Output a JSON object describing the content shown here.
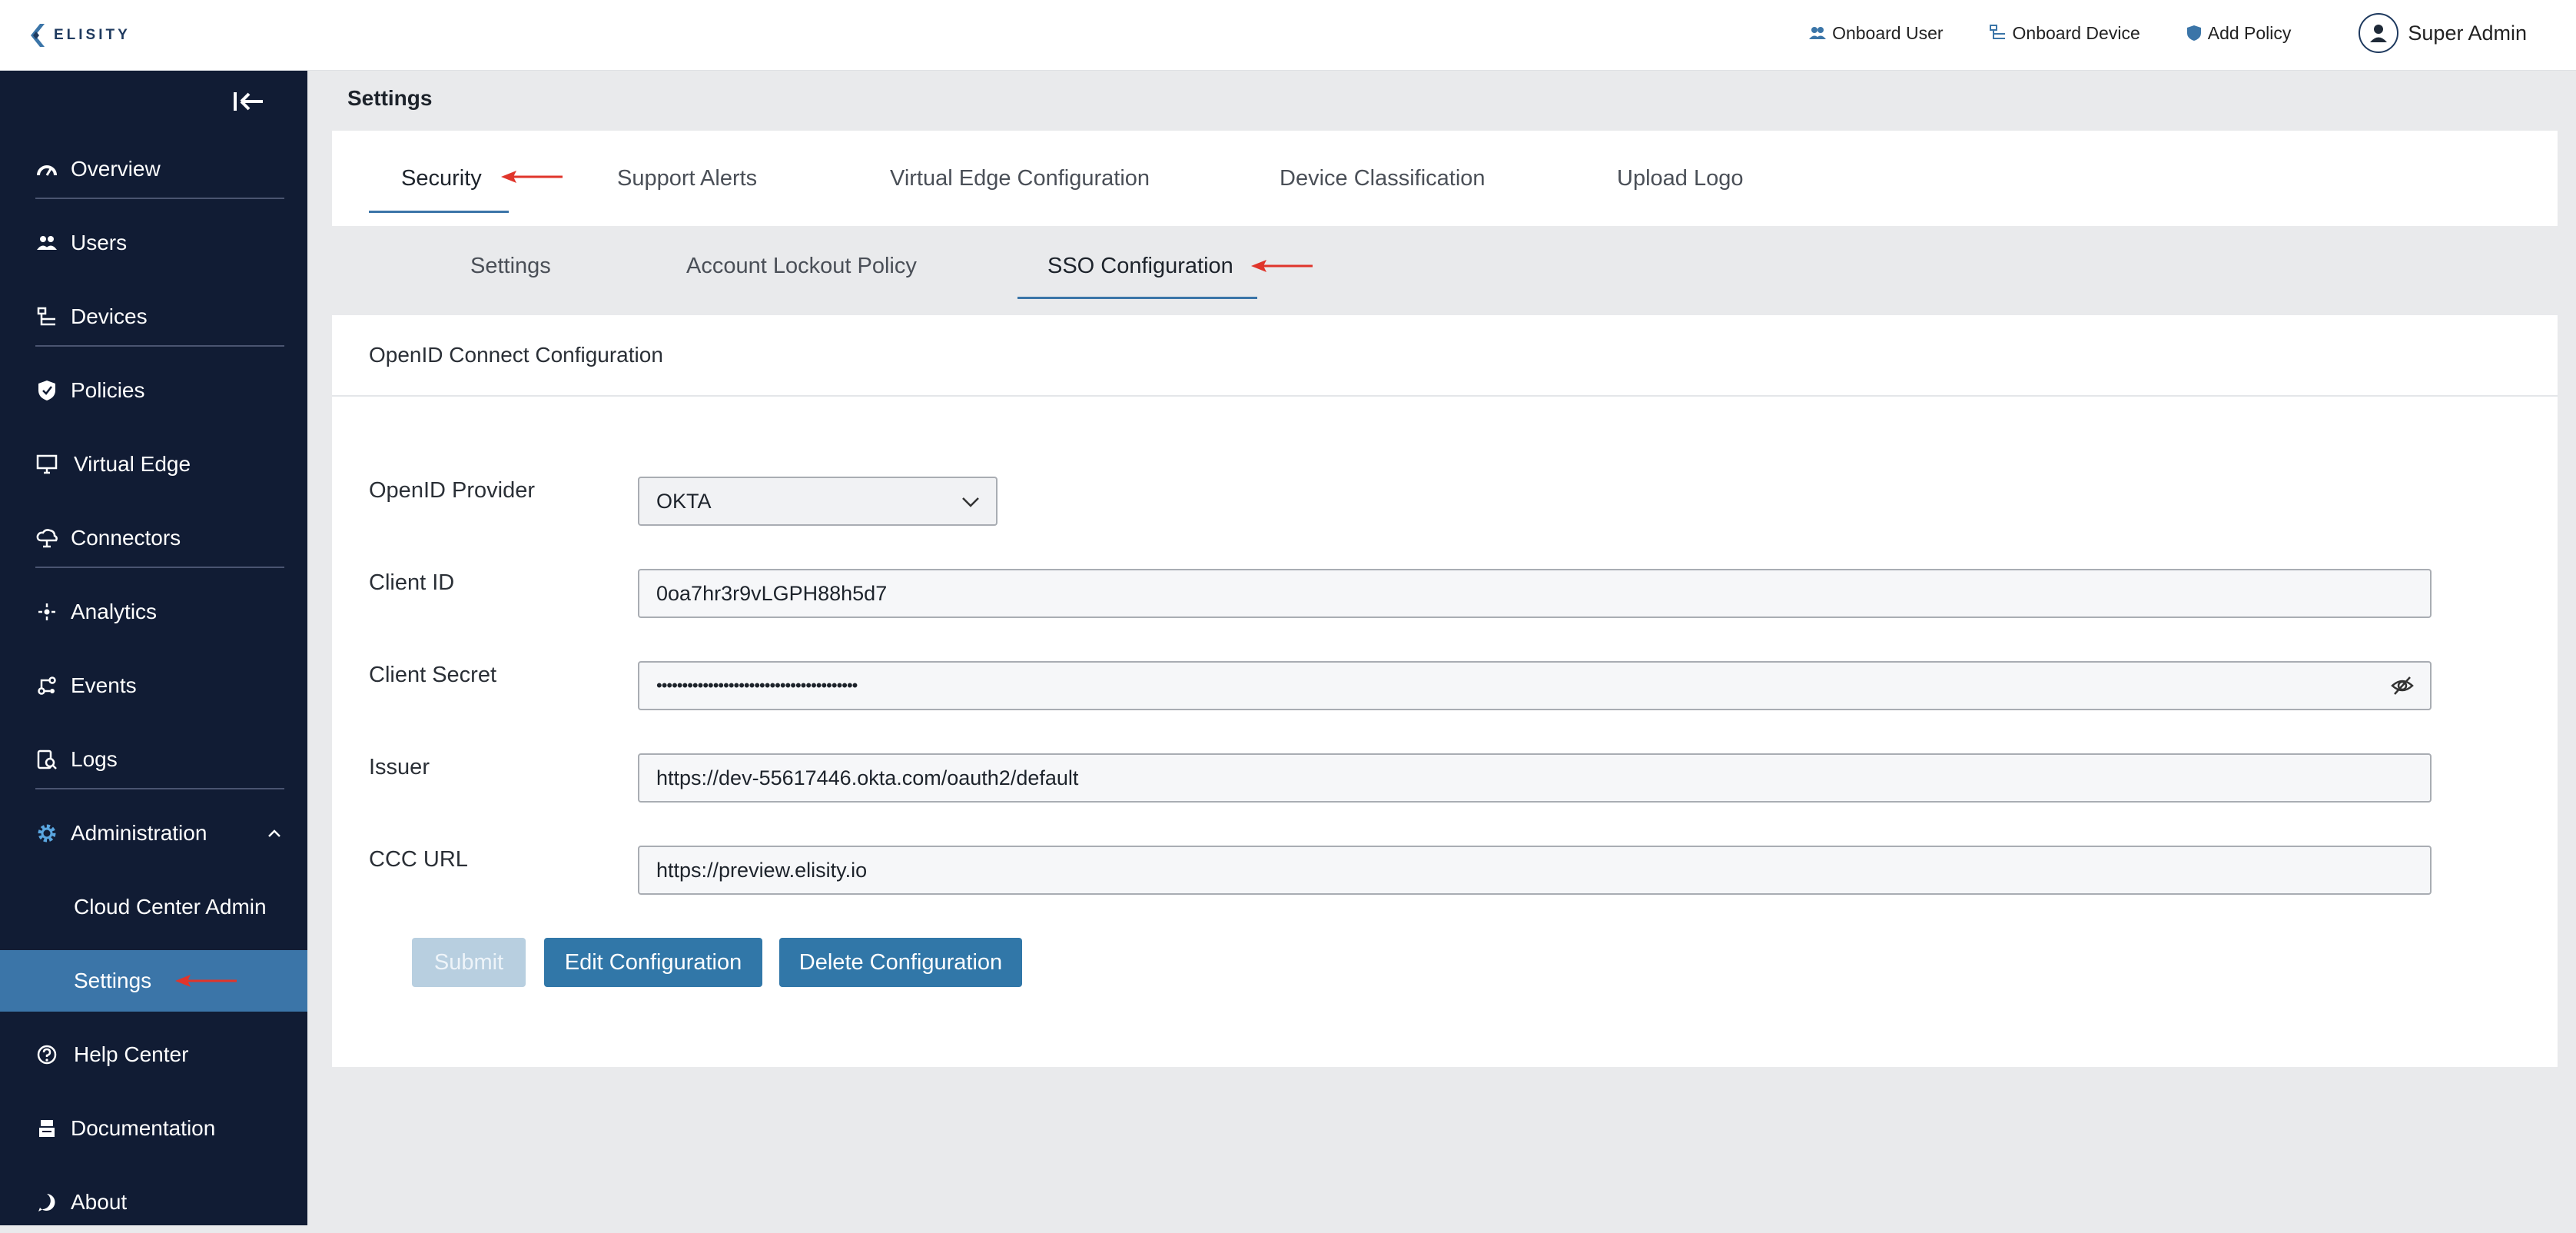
{
  "app": {
    "brand": "ELISITY"
  },
  "topbar": {
    "actions": [
      {
        "label": "Onboard User",
        "icon": "users-icon"
      },
      {
        "label": "Onboard Device",
        "icon": "device-icon"
      },
      {
        "label": "Add Policy",
        "icon": "shield-icon"
      }
    ],
    "user": {
      "name": "Super Admin",
      "icon": "user-avatar-icon"
    }
  },
  "sidebar": {
    "items": [
      {
        "label": "Overview",
        "icon": "gauge-icon"
      },
      {
        "label": "Users",
        "icon": "users-icon"
      },
      {
        "label": "Devices",
        "icon": "device-tree-icon"
      },
      {
        "label": "Policies",
        "icon": "shield-icon"
      },
      {
        "label": "Virtual Edge",
        "icon": "monitor-icon"
      },
      {
        "label": "Connectors",
        "icon": "cloud-icon"
      },
      {
        "label": "Analytics",
        "icon": "analytics-icon"
      },
      {
        "label": "Events",
        "icon": "events-icon"
      },
      {
        "label": "Logs",
        "icon": "logs-icon"
      },
      {
        "label": "Administration",
        "icon": "gear-icon"
      },
      {
        "label": "Cloud Center Admin"
      },
      {
        "label": "Settings",
        "active": true
      },
      {
        "label": "Help Center",
        "icon": "help-icon"
      },
      {
        "label": "Documentation",
        "icon": "documentation-icon"
      },
      {
        "label": "About",
        "icon": "info-icon"
      }
    ]
  },
  "page": {
    "title": "Settings"
  },
  "tabs": [
    {
      "label": "Security",
      "active": true
    },
    {
      "label": "Support Alerts"
    },
    {
      "label": "Virtual Edge Configuration"
    },
    {
      "label": "Device Classification"
    },
    {
      "label": "Upload Logo"
    }
  ],
  "subtabs": [
    {
      "label": "Settings"
    },
    {
      "label": "Account Lockout Policy"
    },
    {
      "label": "SSO Configuration",
      "active": true
    }
  ],
  "card": {
    "title": "OpenID Connect Configuration",
    "fields": {
      "provider": {
        "label": "OpenID Provider",
        "value": "OKTA"
      },
      "client_id": {
        "label": "Client ID",
        "value": "0oa7hr3r9vLGPH88h5d7"
      },
      "client_secret": {
        "label": "Client Secret",
        "value": "•••••••••••••••••••••••••••••••••••••••"
      },
      "issuer": {
        "label": "Issuer",
        "value": "https://dev-55617446.okta.com/oauth2/default"
      },
      "ccc_url": {
        "label": "CCC URL",
        "value": "https://preview.elisity.io"
      }
    },
    "buttons": {
      "submit": "Submit",
      "edit": "Edit Configuration",
      "delete": "Delete Configuration"
    }
  },
  "colors": {
    "sidebar_bg": "#111c34",
    "accent": "#3177a8",
    "active_nav": "#3b75a8",
    "annotation_arrow": "#e0352b"
  }
}
